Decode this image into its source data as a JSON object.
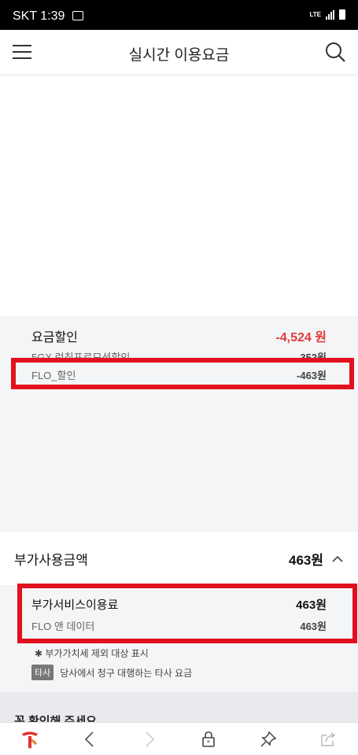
{
  "status_bar": {
    "carrier_time": "SKT 1:39",
    "network": "LTE"
  },
  "header": {
    "title": "실시간 이용요금"
  },
  "discount": {
    "label": "요금할인",
    "amount": "-4,524 원",
    "items": [
      {
        "label": "5GX 런칭프로모션할인",
        "amount": "-352원"
      },
      {
        "label": "FLO_할인",
        "amount": "-463원"
      }
    ]
  },
  "addon": {
    "label": "부가사용금액",
    "amount": "463원",
    "service_label": "부가서비스이용료",
    "service_amount": "463원",
    "item_label": "FLO 앤 데이터",
    "item_amount": "463원"
  },
  "notes": {
    "vat": "✱  부가가치세 제외 대상 표시",
    "badge": "타사",
    "third_party": "당사에서 청구 대행하는 타사 요금"
  },
  "next_section": {
    "label": "꼭 확인해 주세요"
  },
  "colors": {
    "highlight": "#e1111f",
    "discount": "#e23b3b",
    "brand": "#e2322b"
  }
}
